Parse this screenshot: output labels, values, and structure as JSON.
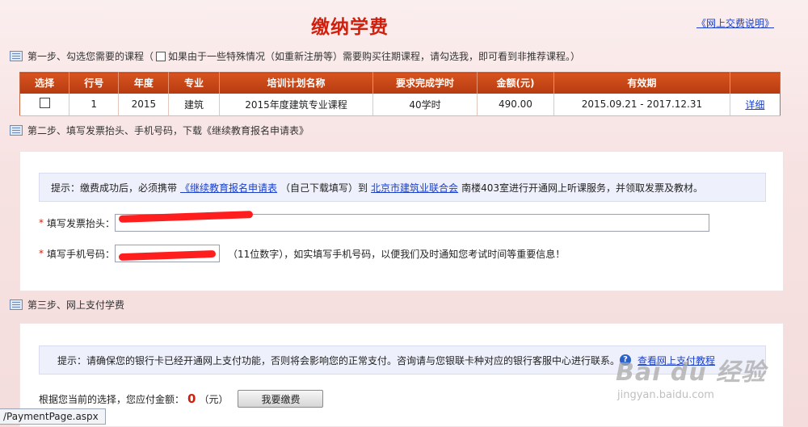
{
  "header": {
    "title": "缴纳学费",
    "help_link": "《网上交费说明》"
  },
  "step1": {
    "label": "第一步、勾选您需要的课程（",
    "label_tail": "如果由于一些特殊情况（如重新注册等）需要购买往期课程，请勾选我，即可看到非推荐课程。）"
  },
  "table": {
    "headers": [
      "选择",
      "行号",
      "年度",
      "专业",
      "培训计划名称",
      "要求完成学时",
      "金额(元)",
      "有效期",
      ""
    ],
    "rows": [
      {
        "row_no": "1",
        "year": "2015",
        "major": "建筑",
        "plan": "2015年度建筑专业课程",
        "hours": "40学时",
        "amount": "490.00",
        "validity": "2015.09.21 - 2017.12.31",
        "detail": "详细"
      }
    ]
  },
  "step2": {
    "label": "第二步、填写发票抬头、手机号码，下载《继续教育报名申请表》"
  },
  "tip1": {
    "prefix": "提示：缴费成功后，必须携带",
    "form_link": "《继续教育报名申请表",
    "middle": "（自己下载填写）到",
    "org_link": "北京市建筑业联合会",
    "suffix": "南楼403室进行开通网上听课服务，并领取发票及教材。"
  },
  "invoice": {
    "label": "填写发票抬头：",
    "value": ""
  },
  "phone": {
    "label": "填写手机号码：",
    "value": "",
    "note": "（11位数字），如实填写手机号码，以便我们及时通知您考试时间等重要信息！"
  },
  "step3": {
    "label": "第三步、网上支付学费"
  },
  "tip2": {
    "text": "提示：请确保您的银行卡已经开通网上支付功能，否则将会影响您的正常支付。咨询请与您银联卡种对应的银行客服中心进行联系。",
    "link": "查看网上支付教程"
  },
  "payment": {
    "prefix": "根据您当前的选择，您应付金额：",
    "amount": "0",
    "unit": "（元）",
    "button": "我要缴费"
  },
  "status_bar": {
    "text": "/PaymentPage.aspx"
  },
  "watermark": {
    "main": "Bai du 经验",
    "sub": "jingyan.baidu.com"
  },
  "colors": {
    "title_red": "#d11f0e",
    "table_header": "#c84418",
    "link_blue": "#1a3fc8",
    "redaction": "#ff1e1e"
  }
}
